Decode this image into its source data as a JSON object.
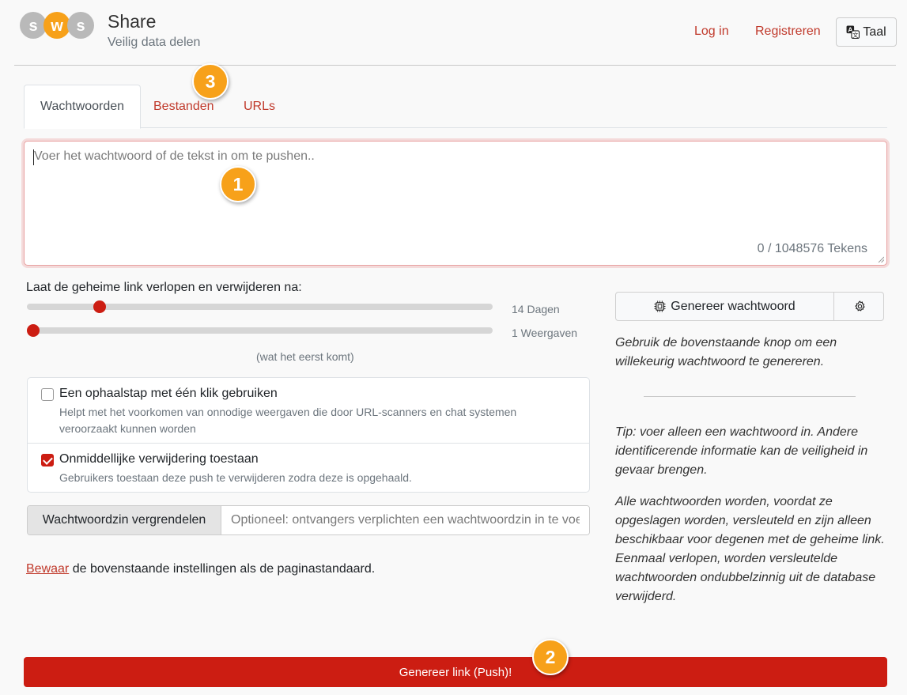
{
  "brand": {
    "logo_text": "sws",
    "title": "Share",
    "subtitle": "Veilig data delen",
    "logo_colors": [
      "#b9b9b9",
      "#f7a11a",
      "#b9b9b9"
    ]
  },
  "nav": {
    "login": "Log in",
    "register": "Registreren",
    "language": "Taal",
    "language_icon": "translate-icon"
  },
  "tabs": [
    {
      "label": "Wachtwoorden",
      "active": true
    },
    {
      "label": "Bestanden",
      "active": false
    },
    {
      "label": "URLs",
      "active": false
    }
  ],
  "payload": {
    "placeholder": "Voer het wachtwoord of de tekst in om te pushen..",
    "counter": "0 / 1048576 Tekens"
  },
  "expiration": {
    "label": "Laat de geheime link verlopen en verwijderen na:",
    "days": {
      "value": 14,
      "max": 90,
      "label": "14 Dagen"
    },
    "views": {
      "value": 1,
      "max": 100,
      "label": "1 Weergaven"
    },
    "note": "(wat het eerst komt)"
  },
  "options": [
    {
      "title": "Een ophaalstap met één klik gebruiken",
      "help": "Helpt met het voorkomen van onnodige weergaven die door URL-scanners en chat systemen veroorzaakt kunnen worden",
      "checked": false
    },
    {
      "title": "Onmiddellijke verwijdering toestaan",
      "help": "Gebruikers toestaan deze push te verwijderen zodra deze is opgehaald.",
      "checked": true
    }
  ],
  "passphrase": {
    "label": "Wachtwoordzin vergrendelen",
    "placeholder": "Optioneel: ontvangers verplichten een wachtwoordzin in te voeren"
  },
  "save": {
    "link": "Bewaar",
    "rest": " de bovenstaande instellingen als de paginastandaard."
  },
  "generator": {
    "button": "Genereer wachtwoord",
    "button_icon": "chip-icon",
    "settings_icon": "gear-icon"
  },
  "help": {
    "generator": "Gebruik de bovenstaande knop om een willekeurig wachtwoord te genereren.",
    "tip": "Tip: voer alleen een wachtwoord in. Andere identificerende informatie kan de veiligheid in gevaar brengen.",
    "security": "Alle wachtwoorden worden, voordat ze opgeslagen worden, versleuteld en zijn alleen beschikbaar voor degenen met de geheime link. Eenmaal verlopen, worden versleutelde wachtwoorden ondubbelzinnig uit de database verwijderd."
  },
  "push": {
    "label": "Genereer link (Push)!"
  },
  "badges": [
    "1",
    "2",
    "3"
  ],
  "colors": {
    "accent": "#cc1d12",
    "link": "#c0392b",
    "badge": "#f7a11a"
  }
}
